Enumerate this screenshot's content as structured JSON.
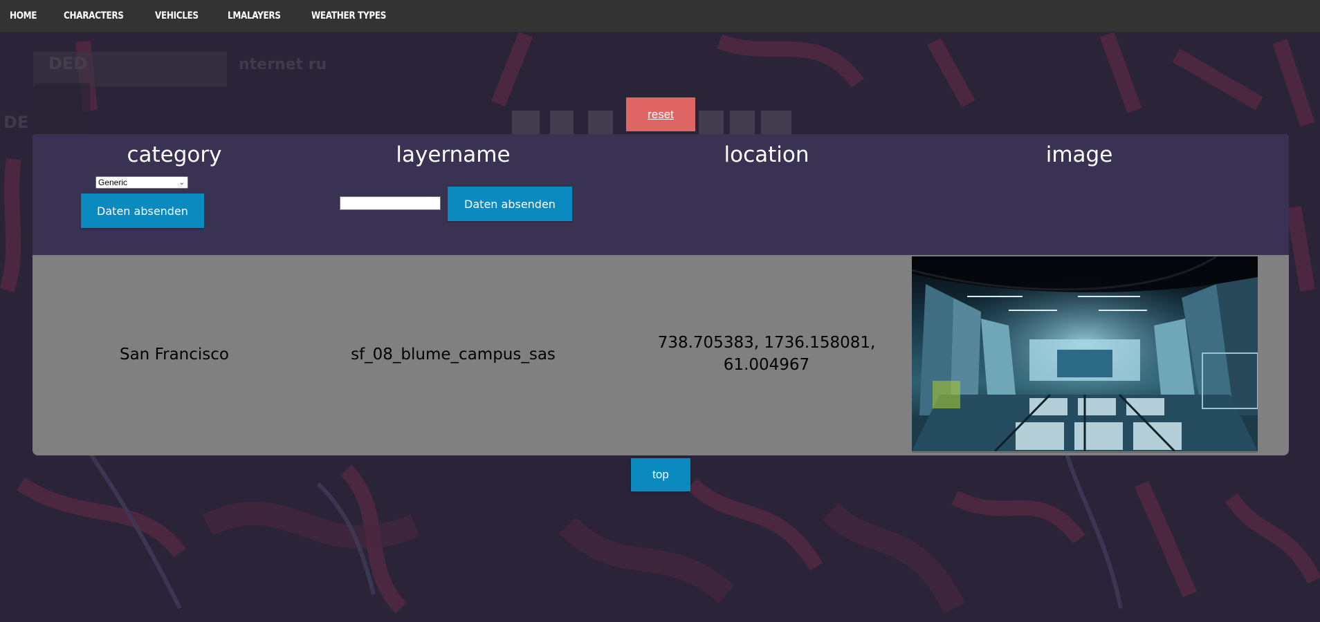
{
  "nav": {
    "items": [
      {
        "label": "HOME"
      },
      {
        "label": "CHARACTERS"
      },
      {
        "label": "VEHICLES"
      },
      {
        "label": "LMALAYERS"
      },
      {
        "label": "WEATHER TYPES"
      }
    ]
  },
  "reset_label": "reset",
  "table": {
    "headers": {
      "category": "category",
      "layername": "layername",
      "location": "location",
      "image": "image"
    },
    "category_select": {
      "value": "Generic"
    },
    "category_submit_label": "Daten absenden",
    "layername_input": {
      "value": "",
      "placeholder": ""
    },
    "layername_submit_label": "Daten absenden",
    "rows": [
      {
        "category": "San Francisco",
        "layername": "sf_08_blume_campus_sas",
        "location_line1": "738.705383, 1736.158081,",
        "location_line2": "61.004967",
        "image": "blume-campus-interior-photo"
      }
    ]
  },
  "top_label": "top",
  "colors": {
    "navbar": "#333333",
    "header_panel": "#3a3252",
    "row_panel": "#808080",
    "reset_button": "#e06666",
    "blue_button": "#0a8abf",
    "page_background": "#2b2338"
  }
}
